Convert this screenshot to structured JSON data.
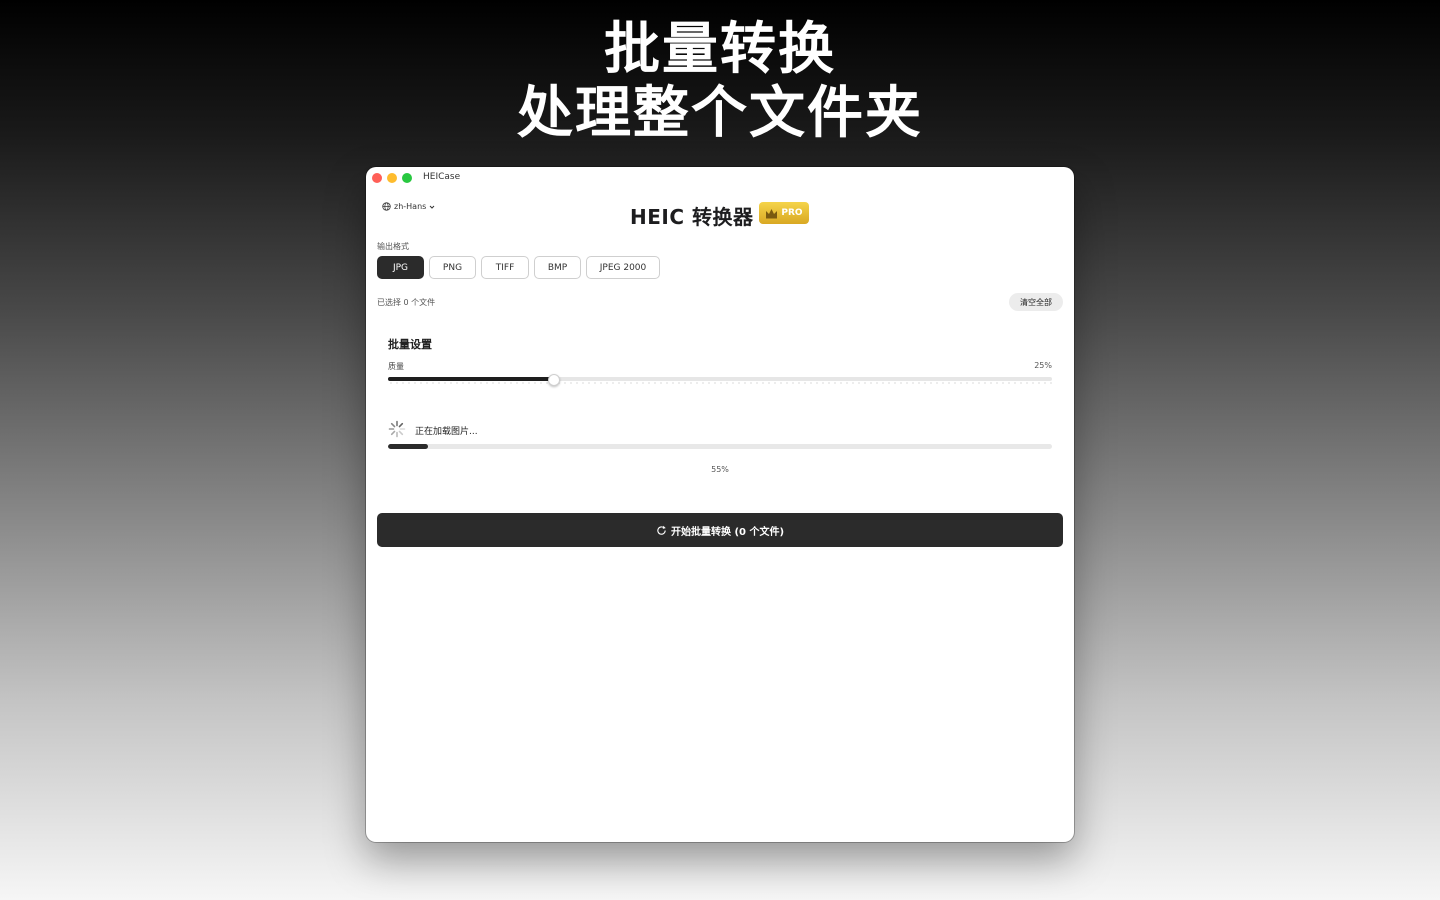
{
  "promo": {
    "headline_line1": "批量转换",
    "headline_line2": "处理整个文件夹"
  },
  "window": {
    "title": "HEICase"
  },
  "toolbar": {
    "language_label": "zh-Hans",
    "language_icon": "globe-icon",
    "language_chevron": "chevron-down-icon"
  },
  "header": {
    "title": "HEIC 转换器",
    "badge_icon": "crown-icon",
    "badge_label": "PRO",
    "badge_color": "#e3b52f"
  },
  "output_format": {
    "label": "输出格式",
    "options": [
      "JPG",
      "PNG",
      "TIFF",
      "BMP",
      "JPEG 2000"
    ],
    "selected": "JPG"
  },
  "files": {
    "selected_text": "已选择 0 个文件",
    "clear_all_label": "清空全部"
  },
  "batch_settings": {
    "title": "批量设置",
    "quality_label": "质量",
    "quality_value_text": "25%",
    "quality_fraction": 0.25
  },
  "loading": {
    "text": "正在加载图片...",
    "progress_text": "55%",
    "progress_fraction": 0.06
  },
  "actions": {
    "start_icon": "refresh-icon",
    "start_label": "开始批量转换 (0 个文件)"
  },
  "colors": {
    "accent_dark": "#2b2b2b",
    "close": "#ff5f57",
    "minimize": "#febc2e",
    "zoom": "#28c840"
  }
}
